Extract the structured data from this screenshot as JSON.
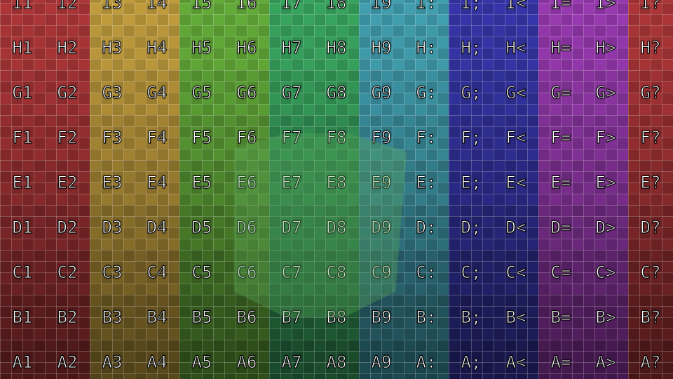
{
  "texture": {
    "rows": [
      "I",
      "H",
      "G",
      "F",
      "E",
      "D",
      "C",
      "B",
      "A"
    ],
    "columns": [
      "1",
      "2",
      "3",
      "4",
      "5",
      "6",
      "7",
      "8",
      "9",
      ":",
      ";",
      "<",
      "=",
      ">",
      "?"
    ],
    "column_colors": [
      "#b5383a",
      "#b5383a",
      "#c9a33e",
      "#c9a33e",
      "#68b43b",
      "#68b43b",
      "#3aad63",
      "#3aad63",
      "#43a6b8",
      "#43a6b8",
      "#3838b2",
      "#3838b2",
      "#9f3cb8",
      "#9f3cb8",
      "#b5383a"
    ],
    "row_brightness": [
      0.95,
      0.92,
      0.86,
      0.8,
      0.74,
      0.66,
      0.58,
      0.5,
      0.44
    ]
  }
}
